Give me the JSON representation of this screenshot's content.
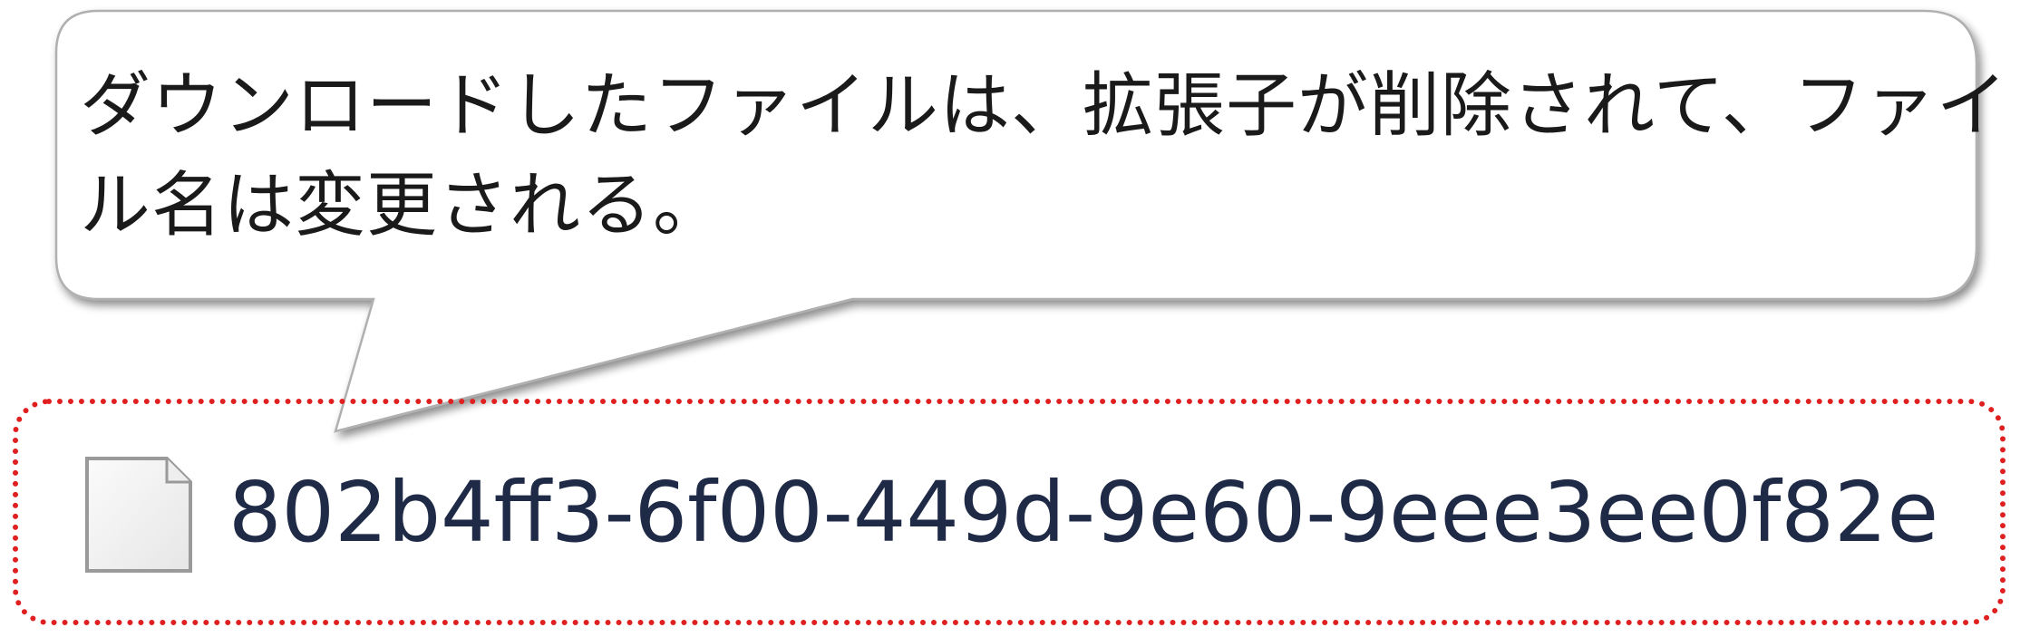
{
  "callout": {
    "line1": "ダウンロードしたファイルは、拡張子が削除されて、ファイ",
    "line2": "ル名は変更される。"
  },
  "file": {
    "icon": "blank-file-icon",
    "name": "802b4ff3-6f00-449d-9e60-9eee3ee0f82e"
  },
  "colors": {
    "highlight_border": "#e02020",
    "filename_text": "#1e2a46",
    "callout_border": "#b0b0b0"
  }
}
